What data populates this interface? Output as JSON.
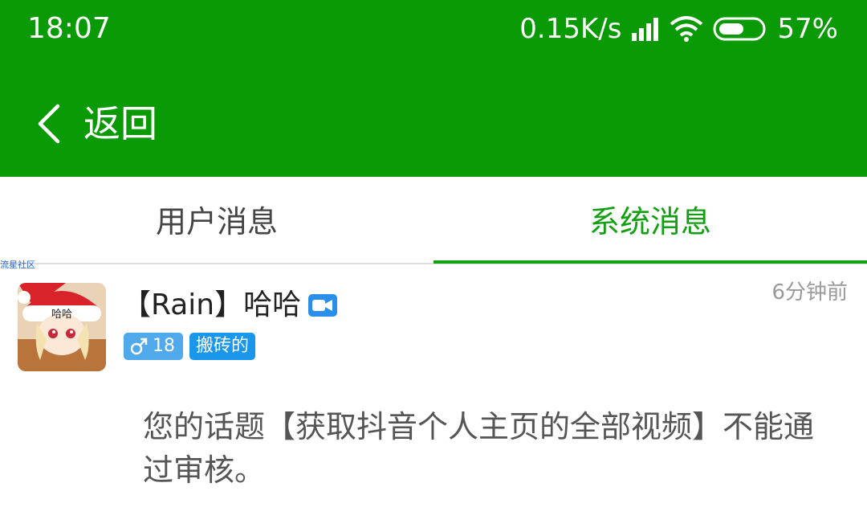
{
  "status_bar": {
    "time": "18:07",
    "speed": "0.15K/s",
    "battery": "57%",
    "battery_level": 0.57,
    "icons": [
      "signal-icon",
      "wifi-icon",
      "battery-icon"
    ]
  },
  "header": {
    "back_label": "返回",
    "background": "#0a9a05"
  },
  "tabs": [
    {
      "label": "用户消息",
      "active": false
    },
    {
      "label": "系统消息",
      "active": true
    }
  ],
  "watermark": "流星社区",
  "message": {
    "username": "【Rain】哈哈",
    "time_ago": "6分钟前",
    "gender_badge": "18",
    "title_badge": "搬砖的",
    "avatar_text": "哈哈",
    "content": "您的话题【获取抖音个人主页的全部视频】不能通过审核。"
  },
  "colors": {
    "accent": "#0a9a05",
    "active_tab": "#12a012",
    "badge_gender": "#4fa9ea",
    "badge_title": "#1a96ea"
  }
}
